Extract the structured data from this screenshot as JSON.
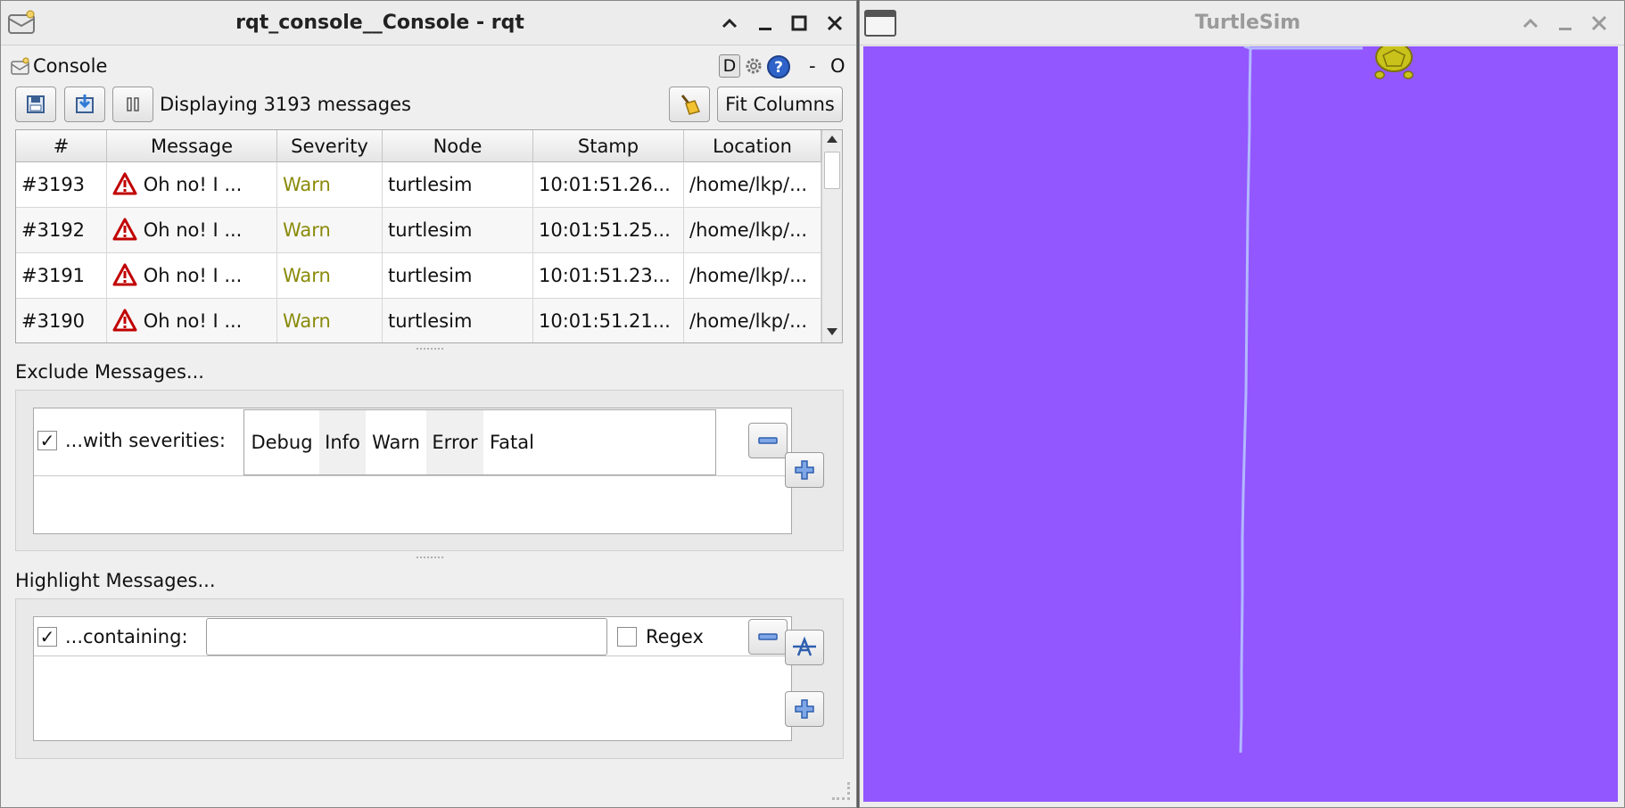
{
  "console_window": {
    "title": "rqt_console__Console - rqt",
    "plugin_title": "Console",
    "plugin_controls": {
      "d_label": "D",
      "dash_label": "-",
      "o_label": "O"
    },
    "toolbar": {
      "status": "Displaying 3193 messages",
      "fit_columns": "Fit Columns"
    },
    "table": {
      "columns": [
        "#",
        "Message",
        "Severity",
        "Node",
        "Stamp",
        "Location"
      ],
      "rows": [
        {
          "num": "#3193",
          "message": "Oh no! I ...",
          "severity": "Warn",
          "node": "turtlesim",
          "stamp": "10:01:51.26...",
          "location": "/home/lkp/..."
        },
        {
          "num": "#3192",
          "message": "Oh no! I ...",
          "severity": "Warn",
          "node": "turtlesim",
          "stamp": "10:01:51.25...",
          "location": "/home/lkp/..."
        },
        {
          "num": "#3191",
          "message": "Oh no! I ...",
          "severity": "Warn",
          "node": "turtlesim",
          "stamp": "10:01:51.23...",
          "location": "/home/lkp/..."
        },
        {
          "num": "#3190",
          "message": "Oh no! I ...",
          "severity": "Warn",
          "node": "turtlesim",
          "stamp": "10:01:51.21...",
          "location": "/home/lkp/..."
        }
      ]
    },
    "exclude": {
      "title": "Exclude Messages...",
      "filter_label": "...with severities:",
      "checked": true,
      "severities": [
        "Debug",
        "Info",
        "Warn",
        "Error",
        "Fatal"
      ]
    },
    "highlight": {
      "title": "Highlight Messages...",
      "filter_label": "...containing:",
      "checked": true,
      "text_value": "",
      "regex_label": "Regex",
      "regex_checked": false
    }
  },
  "turtlesim_window": {
    "title": "TurtleSim",
    "background_color": "#9257ff",
    "pen_color": "#b3b8ff"
  },
  "colors": {
    "warn_text": "#8a8a0a",
    "warning_icon": "#c00000"
  }
}
